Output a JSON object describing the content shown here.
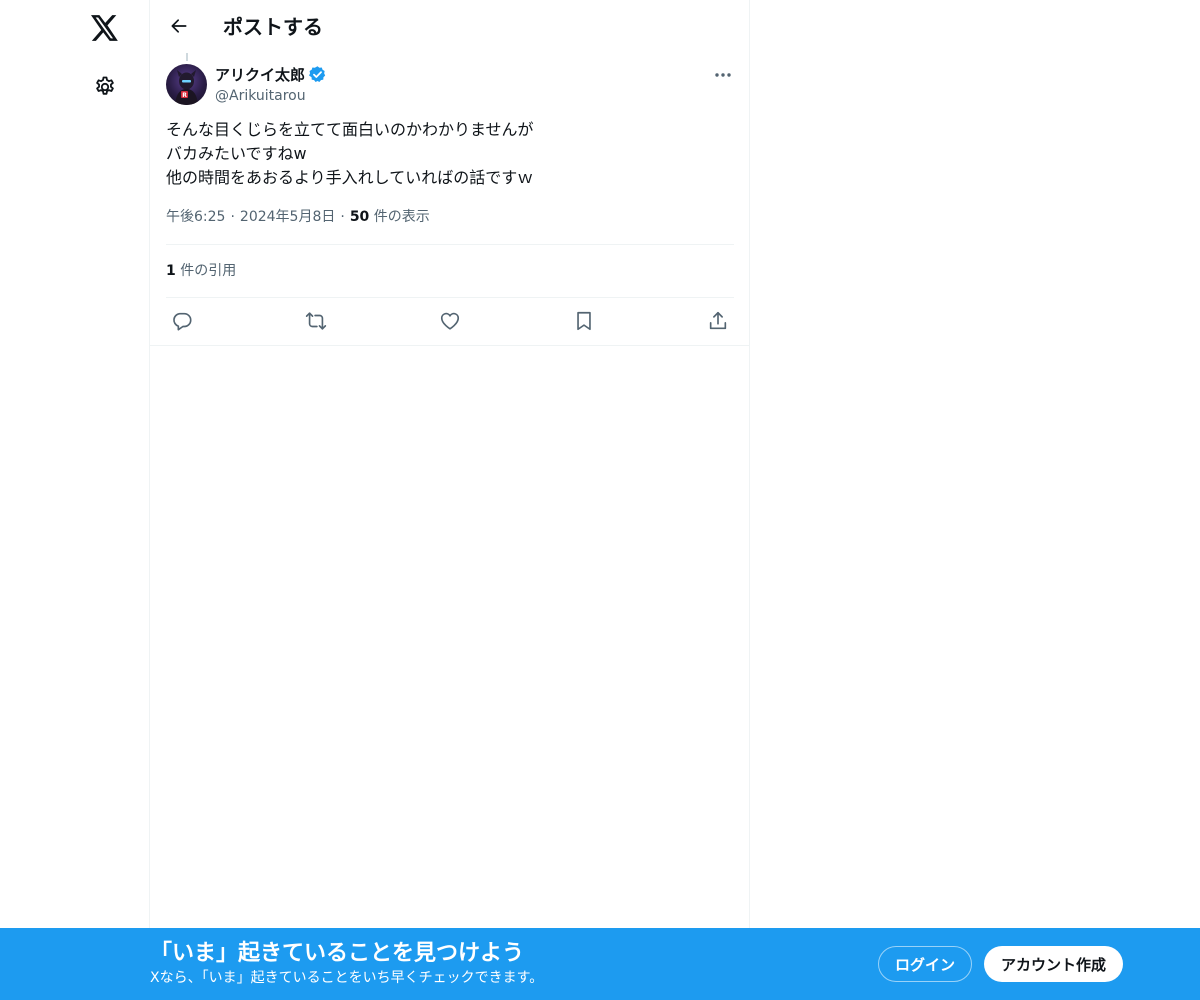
{
  "header": {
    "title": "ポストする"
  },
  "post": {
    "author": {
      "display_name": "アリクイ太郎",
      "handle": "@Arikuitarou",
      "verified": true
    },
    "text_lines": [
      "そんな目くじらを立てて面白いのかわかりませんが",
      "バカみたいですねw",
      "他の時間をあおるより手入れしていればの話ですｗ"
    ],
    "time": "午後6:25",
    "date": "2024年5月8日",
    "separator": "·",
    "views_count": "50",
    "views_label": "件の表示",
    "quotes_count": "1",
    "quotes_label": "件の引用"
  },
  "actions": {
    "reply": "reply-icon",
    "repost": "repost-icon",
    "like": "heart-icon",
    "bookmark": "bookmark-icon",
    "share": "share-icon"
  },
  "banner": {
    "headline": "「いま」起きていることを見つけよう",
    "subtext": "Xなら、「いま」起きていることをいち早くチェックできます。",
    "login_label": "ログイン",
    "signup_label": "アカウント作成"
  },
  "colors": {
    "accent": "#1d9bf0",
    "text_primary": "#0f1419",
    "text_secondary": "#536471",
    "border": "#eff3f4"
  }
}
